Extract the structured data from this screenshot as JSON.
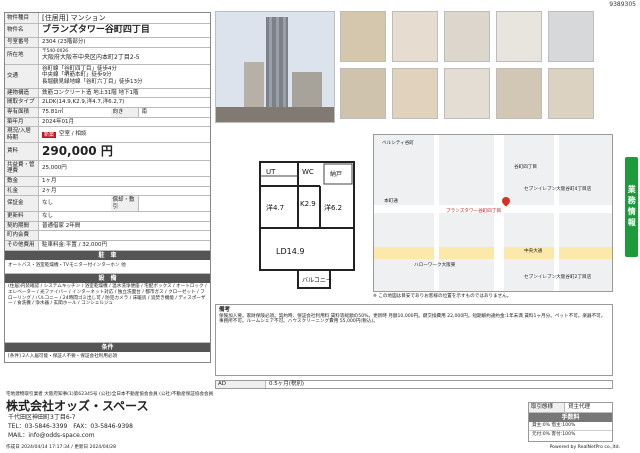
{
  "sheet_no": "9389305",
  "property": {
    "type_label": "物件種目",
    "type": "[住居用] マンション",
    "name_label": "物件名",
    "name": "ブランズタワー谷町四丁目",
    "room_label": "号室番号",
    "room": "2304 (23階部分)",
    "address_label": "所在地",
    "zip": "〒540-0026",
    "address": "大阪府大阪市中央区内本町2丁目2-5",
    "access_label": "交通",
    "access": [
      "谷町線「谷町四丁目」徒歩4分",
      "中央線「堺筋本町」徒歩9分",
      "長堀鶴見緑地線「谷町六丁目」徒歩13分"
    ],
    "structure_label": "建物構造",
    "structure": "鉄筋コンクリート造 地上31階 地下1階",
    "layout_label": "間取タイプ",
    "layout": "2LDK(14.9,K2.9,洋4.7,洋6.2,7)",
    "area_label": "専有面積",
    "area": "75.81㎡",
    "direction_label": "向き",
    "direction": "南",
    "built_label": "築年月",
    "built": "2024年01月",
    "status_label": "現況/入居時期",
    "new_tag": "新築",
    "status": "空室 / 相談",
    "rent_label": "賃料",
    "rent": "290,000 円",
    "fee_label": "共益費・管理費",
    "fee": "25,000円",
    "deposit_label": "敷金",
    "deposit": "1ヶ月",
    "key_label": "礼金",
    "key": "2ヶ月",
    "guarantee_label": "保証金",
    "guarantee": "なし",
    "amort_label": "償却・敷引",
    "amort": "",
    "renew_label": "更新料",
    "renew": "なし",
    "contract_label": "契約期間",
    "contract": "普通借家 2年間",
    "area_opt_label": "町内会費",
    "area_opt": "",
    "other_label": "その他費用",
    "other": "駐車料金:平置 / 32,000円"
  },
  "parking_head": "駐　車",
  "parking_text": "オートバス・浴室乾燥機・TVモニター付インターホン 他",
  "equip_head": "設　備",
  "equip_text": "(住居)内装確認 / システムキッチン / 浴室乾燥機 / 温水洗浄便座 / 宅配ボックス / オートロック / エレベーター / 光ファイバー / インターネット対応 / 独立洗面台 / 都市ガス / クローゼット / フローリング / バルコニー / 24時間ゴミ出し可 / 防犯カメラ / 床暖房 / 追焚き機能 / ディスポーザー / 食洗機 / 浄水器 / 玄関ホール / コンシェルジュ",
  "conditions_head": "条件",
  "conditions_text": "[条件] 2人入居可能・保証人不要・保証会社利用必須",
  "floorplan": {
    "labels": [
      "UT",
      "WC",
      "洋4.7",
      "K2.9",
      "洋6.2",
      "LD14.9",
      "バルコニー",
      "納戸"
    ]
  },
  "map_labels": [
    "ベルシティ谷町",
    "本町通",
    "谷町四丁目",
    "中央大通",
    "ハローワーク大阪東",
    "セブンイレブン大阪谷町4丁目店",
    "セブンイレブン大阪谷町2丁目店",
    "ブランズタワー谷町四丁目"
  ],
  "map_note": "※ この地図は目安でありお客様の位置を示すものではありません。",
  "remarks_head": "備考",
  "remarks": "保険加入要。家財保険必須。契約時、保証会社利用料 賃料等総額の50%。更新時 月額10,000円。鍵交換費用 22,000円。短期解約違約金:1年未満 賃料1ヶ月分。ペット不可。楽器不可。事務所不可。ルームシェア不可。ハウスクリーニング費用 55,000円(税込)。",
  "ad_label": "AD",
  "ad_value": "0.5ヶ月(税別)",
  "company": {
    "license": "宅地建物取引業者 大阪府知事(1)第62345号 (公社)全日本不動産協会会員 (公社)不動産保証協会会員",
    "name": "株式会社オッズ・スペース",
    "addr": "千代田区神田町3丁目6-7",
    "tel": "TEL：03-5846-3399　FAX：03-5846-9398",
    "mail": "MAIL：info@odds-space.com"
  },
  "trade": {
    "label": "取引態様",
    "value": "貸主代理",
    "fee_head": "手数料",
    "fee_rows": [
      "貸主:0% 借主:100%",
      "元付:0% 客付:100%"
    ]
  },
  "footer_left": "作成日 2024/04/14 17:17:34 / 更新日 2024/04/28",
  "footer_right": "Powered by RealNetPro co.,ltd.",
  "side_tab": "業務情報"
}
